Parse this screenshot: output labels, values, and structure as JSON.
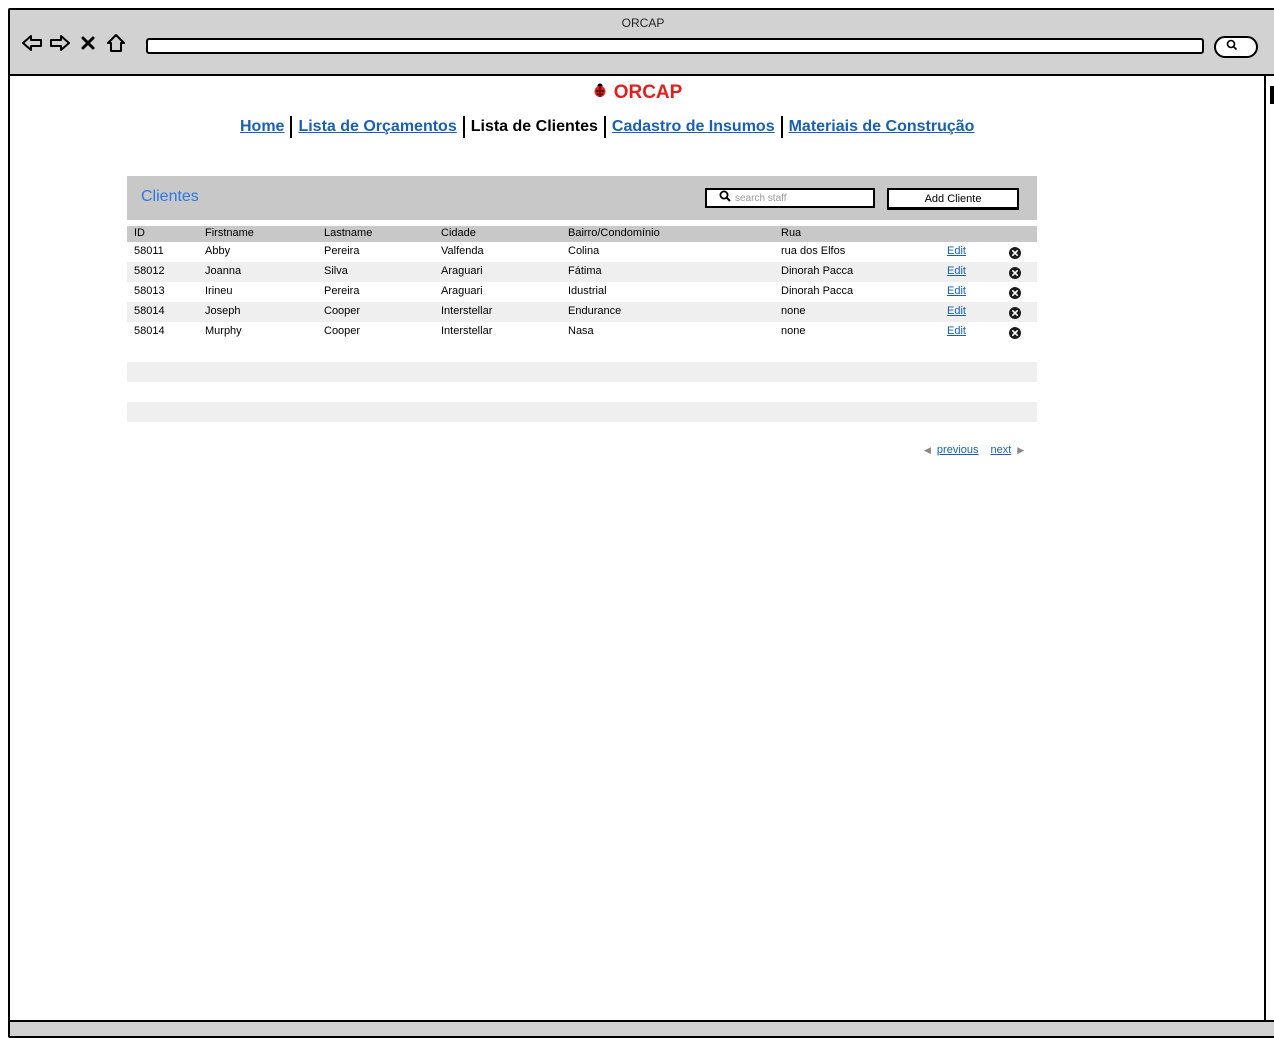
{
  "window": {
    "title": "ORCAP"
  },
  "browser": {
    "nav_icons": [
      "back-arrow-icon",
      "forward-arrow-icon",
      "close-icon",
      "home-icon"
    ],
    "search_icon": "search-icon"
  },
  "header": {
    "logo_text": "ORCAP",
    "logo_icon": "ladybug-icon",
    "brand_color": "#e02020"
  },
  "nav": {
    "home": "Home",
    "orcamentos": "Lista de Orçamentos",
    "clientes": "Lista de Clientes",
    "insumos": "Cadastro de Insumos",
    "materiais": "Materiais de Construção",
    "link_color": "#1a5fb4"
  },
  "panel": {
    "title": "Clientes",
    "search_placeholder": "search staff",
    "add_button": "Add Cliente",
    "title_color": "#2b78e4"
  },
  "table": {
    "columns": [
      "ID",
      "Firstname",
      "Lastname",
      "Cidade",
      "Bairro/Condomínio",
      "Rua"
    ],
    "edit_label": "Edit",
    "rows": [
      [
        "58011",
        "Abby",
        "Pereira",
        "Valfenda",
        "Colina",
        "rua dos Elfos"
      ],
      [
        "58012",
        "Joanna",
        "Silva",
        "Araguari",
        "Fátima",
        "Dinorah Pacca"
      ],
      [
        "58013",
        "Irineu",
        "Pereira",
        "Araguari",
        "Idustrial",
        "Dinorah Pacca"
      ],
      [
        "58014",
        "Joseph",
        "Cooper",
        "Interstellar",
        "Endurance",
        "none"
      ],
      [
        "58014",
        "Murphy",
        "Cooper",
        "Interstellar",
        "Nasa",
        "none"
      ]
    ]
  },
  "pager": {
    "previous": "previous",
    "next": "next"
  }
}
